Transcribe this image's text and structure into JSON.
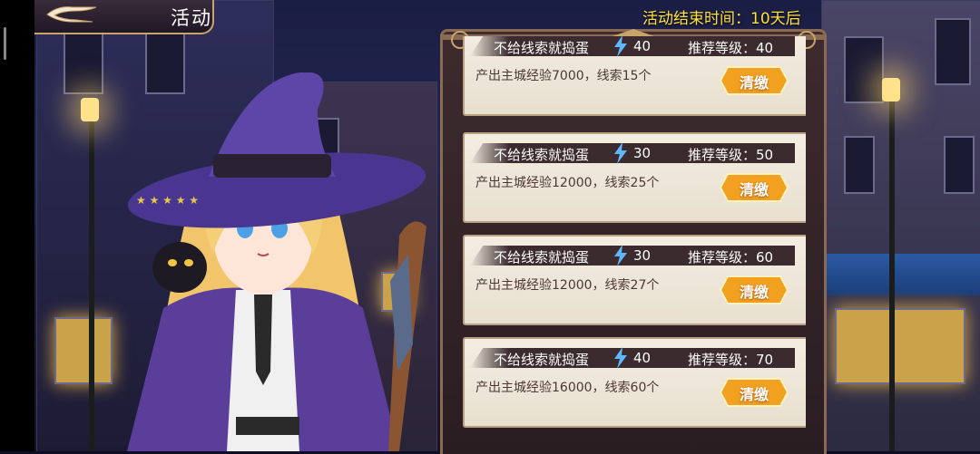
{
  "header": {
    "title": "活动",
    "timer_label": "活动结束时间：",
    "timer_value": "10天后"
  },
  "cards": [
    {
      "name": "不给线索就捣蛋",
      "energy": "40",
      "level_label": "推荐等级：",
      "level": "40",
      "reward": "产出主城经验7000，线索15个",
      "button": "清缴"
    },
    {
      "name": "不给线索就捣蛋",
      "energy": "30",
      "level_label": "推荐等级：",
      "level": "50",
      "reward": "产出主城经验12000，线索25个",
      "button": "清缴"
    },
    {
      "name": "不给线索就捣蛋",
      "energy": "30",
      "level_label": "推荐等级：",
      "level": "60",
      "reward": "产出主城经验12000，线索27个",
      "button": "清缴"
    },
    {
      "name": "不给线索就捣蛋",
      "energy": "40",
      "level_label": "推荐等级：",
      "level": "70",
      "reward": "产出主城经验16000，线索60个",
      "button": "清缴"
    }
  ],
  "colors": {
    "timer": "#ffe23a",
    "button": "#f2a020",
    "panel": "#3d2b2e"
  },
  "icons": {
    "back": "back-arrow-icon",
    "energy": "lightning-icon"
  }
}
